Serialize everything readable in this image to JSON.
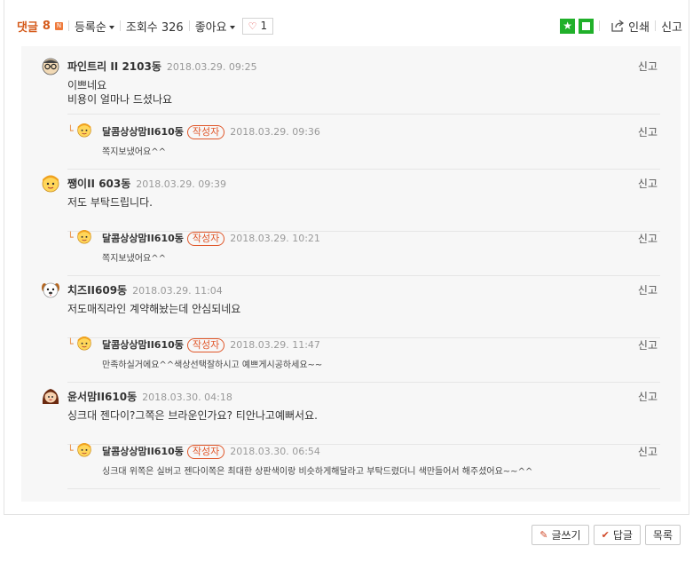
{
  "toolbar": {
    "comments_label": "댓글",
    "comments_count": "8",
    "new_badge": "N",
    "sort_label": "등록순",
    "views_label": "조회수 326",
    "likes_menu_label": "좋아요",
    "like_count": "1",
    "print_label": "인쇄",
    "report_label": "신고"
  },
  "colors": {
    "accent": "#d55a1a",
    "green": "#20b02a",
    "badge": "#e0572a",
    "comment_bg": "#f7f7f7"
  },
  "comments": [
    {
      "type": "comment",
      "nick": "파인트리 II 2103동",
      "date": "2018.03.29. 09:25",
      "lines": [
        "이쁘네요",
        "비용이 얼마나 드셨나요"
      ],
      "report": "신고",
      "avatar": "glasses-avatar-icon"
    },
    {
      "type": "reply",
      "nick": "달콤상상맘II610동",
      "badge": "작성자",
      "date": "2018.03.29. 09:36",
      "lines": [
        "쪽지보냈어요^^"
      ],
      "report": "신고",
      "avatar": "yellow-avatar-icon"
    },
    {
      "type": "comment",
      "nick": "쨍이II 603동",
      "date": "2018.03.29. 09:39",
      "lines": [
        "저도 부탁드립니다."
      ],
      "report": "신고",
      "avatar": "yellow-avatar-icon"
    },
    {
      "type": "reply",
      "nick": "달콤상상맘II610동",
      "badge": "작성자",
      "date": "2018.03.29. 10:21",
      "lines": [
        "쪽지보냈어요^^"
      ],
      "report": "신고",
      "avatar": "yellow-avatar-icon"
    },
    {
      "type": "comment",
      "nick": "치즈II609동",
      "date": "2018.03.29. 11:04",
      "lines": [
        "저도매직라인 계약해놨는데 안심되네요"
      ],
      "report": "신고",
      "avatar": "dog-avatar-icon"
    },
    {
      "type": "reply",
      "nick": "달콤상상맘II610동",
      "badge": "작성자",
      "date": "2018.03.29. 11:47",
      "lines": [
        "만족하실거에요^^색상선택잘하시고 예쁘게시공하세요~~"
      ],
      "report": "신고",
      "avatar": "yellow-avatar-icon"
    },
    {
      "type": "comment",
      "nick": "윤서맘II610동",
      "date": "2018.03.30. 04:18",
      "lines": [
        "싱크대 젠다이?그쪽은 브라운인가요? 티안나고예뻐서요."
      ],
      "report": "신고",
      "avatar": "girl-avatar-icon"
    },
    {
      "type": "reply",
      "nick": "달콤상상맘II610동",
      "badge": "작성자",
      "date": "2018.03.30. 06:54",
      "lines": [
        "싱크대 위쪽은 실버고 젠다이쪽은 최대한 상판색이랑 비슷하게해달라고 부탁드렸더니 색만들어서 해주셨어요~~^^"
      ],
      "report": "신고",
      "avatar": "yellow-avatar-icon"
    }
  ],
  "buttons": {
    "write": "글쓰기",
    "reply": "답글",
    "list": "목록"
  }
}
